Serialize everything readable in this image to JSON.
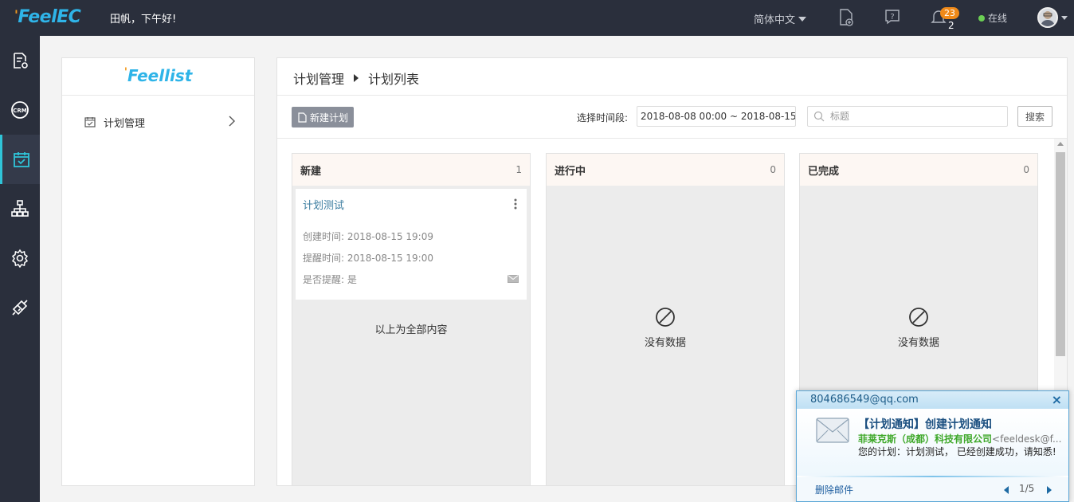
{
  "topbar": {
    "logo": "FeelEC",
    "greeting": "田帆，下午好!",
    "language": "简体中文",
    "notification_badge": "23",
    "notification_count": "2",
    "status": "在线",
    "status_color": "#6bcf54"
  },
  "rail": {
    "items": [
      {
        "icon": "document-settings-icon"
      },
      {
        "icon": "crm-icon"
      },
      {
        "icon": "calendar-check-icon",
        "active": true
      },
      {
        "icon": "org-chart-icon"
      },
      {
        "icon": "gear-icon"
      },
      {
        "icon": "plug-icon"
      }
    ]
  },
  "left_panel": {
    "logo": "Feellist",
    "menu": [
      {
        "label": "计划管理",
        "icon": "calendar-icon"
      }
    ]
  },
  "main": {
    "breadcrumb": {
      "parent": "计划管理",
      "current": "计划列表"
    },
    "toolbar": {
      "new_button": "新建计划",
      "time_label": "选择时间段:",
      "time_range": "2018-08-08 00:00 ~ 2018-08-15 19:",
      "search_placeholder": "标题",
      "search_button": "搜索"
    },
    "columns": [
      {
        "title": "新建",
        "count": "1",
        "cards": [
          {
            "title": "计划测试",
            "created": "创建时间: 2018-08-15 19:09",
            "remind_time": "提醒时间: 2018-08-15 19:00",
            "remind": "是否提醒: 是"
          }
        ],
        "footer": "以上为全部内容"
      },
      {
        "title": "进行中",
        "count": "0",
        "empty": "没有数据"
      },
      {
        "title": "已完成",
        "count": "0",
        "empty": "没有数据"
      }
    ]
  },
  "mail_popup": {
    "account": "804686549@qq.com",
    "title": "【计划通知】创建计划通知",
    "from_org": "菲莱克斯（成都）科技有限公司",
    "from_addr": "<feeldesk@f...",
    "body": "您的计划：计划测试， 已经创建成功，请知悉!",
    "delete": "删除邮件",
    "page": "1/5"
  },
  "colors": {
    "topbar_bg": "#2a2f3c",
    "accent": "#2fb4e8",
    "active_rail": "#2fc4d8",
    "badge": "#f08a19"
  }
}
